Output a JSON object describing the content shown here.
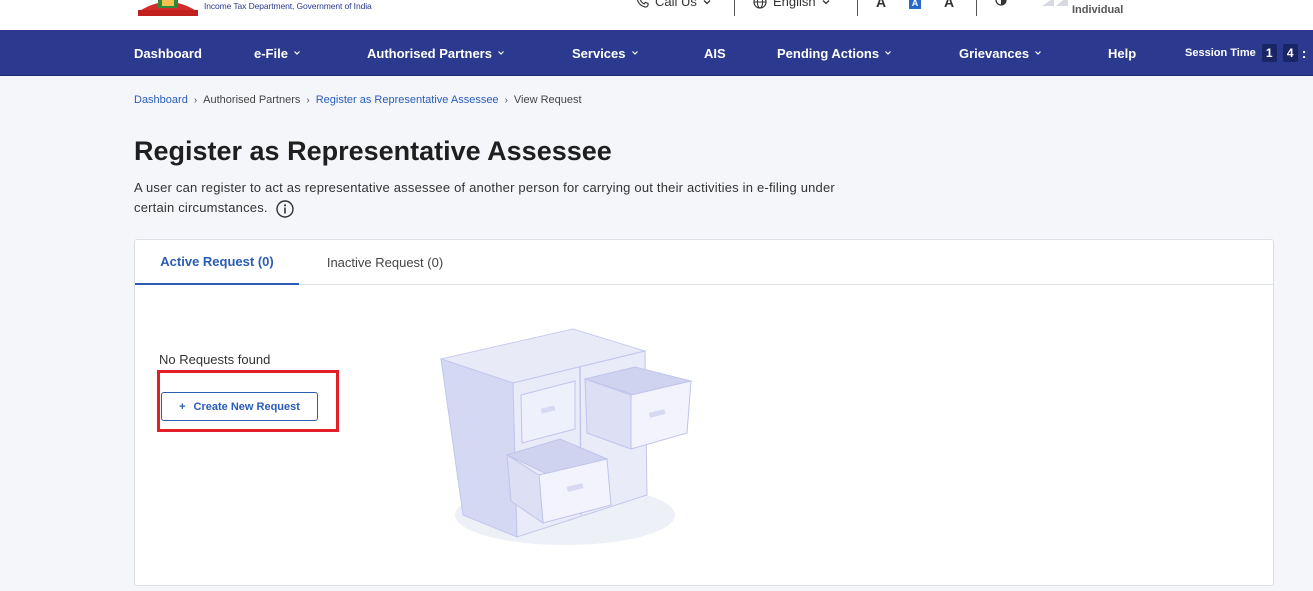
{
  "header": {
    "department": "Income Tax Department, Government of India",
    "call_us": "Call Us",
    "language": "English",
    "font_small": "A",
    "font_default": "A",
    "font_large": "A",
    "user_type": "Individual"
  },
  "nav": {
    "items": [
      {
        "label": "Dashboard",
        "dropdown": false
      },
      {
        "label": "e-File",
        "dropdown": true
      },
      {
        "label": "Authorised Partners",
        "dropdown": true
      },
      {
        "label": "Services",
        "dropdown": true
      },
      {
        "label": "AIS",
        "dropdown": false
      },
      {
        "label": "Pending Actions",
        "dropdown": true
      },
      {
        "label": "Grievances",
        "dropdown": true
      },
      {
        "label": "Help",
        "dropdown": false
      }
    ],
    "session_label": "Session Time",
    "session_digits": [
      "1",
      "4"
    ]
  },
  "breadcrumb": {
    "items": [
      "Dashboard",
      "Authorised Partners",
      "Register as Representative Assessee",
      "View Request"
    ]
  },
  "page": {
    "title": "Register as Representative Assessee",
    "description": "A user can register to act as representative assessee of another person for carrying out their activities in e-filing under certain circumstances."
  },
  "tabs": [
    {
      "label": "Active Request (0)",
      "active": true
    },
    {
      "label": "Inactive Request (0)",
      "active": false
    }
  ],
  "content": {
    "empty_text": "No Requests found",
    "create_button_label": "Create New Request",
    "create_button_icon": "+"
  },
  "colors": {
    "nav_bg": "#2b3a8f",
    "link": "#2a5cb8",
    "highlight": "#e41e26"
  }
}
